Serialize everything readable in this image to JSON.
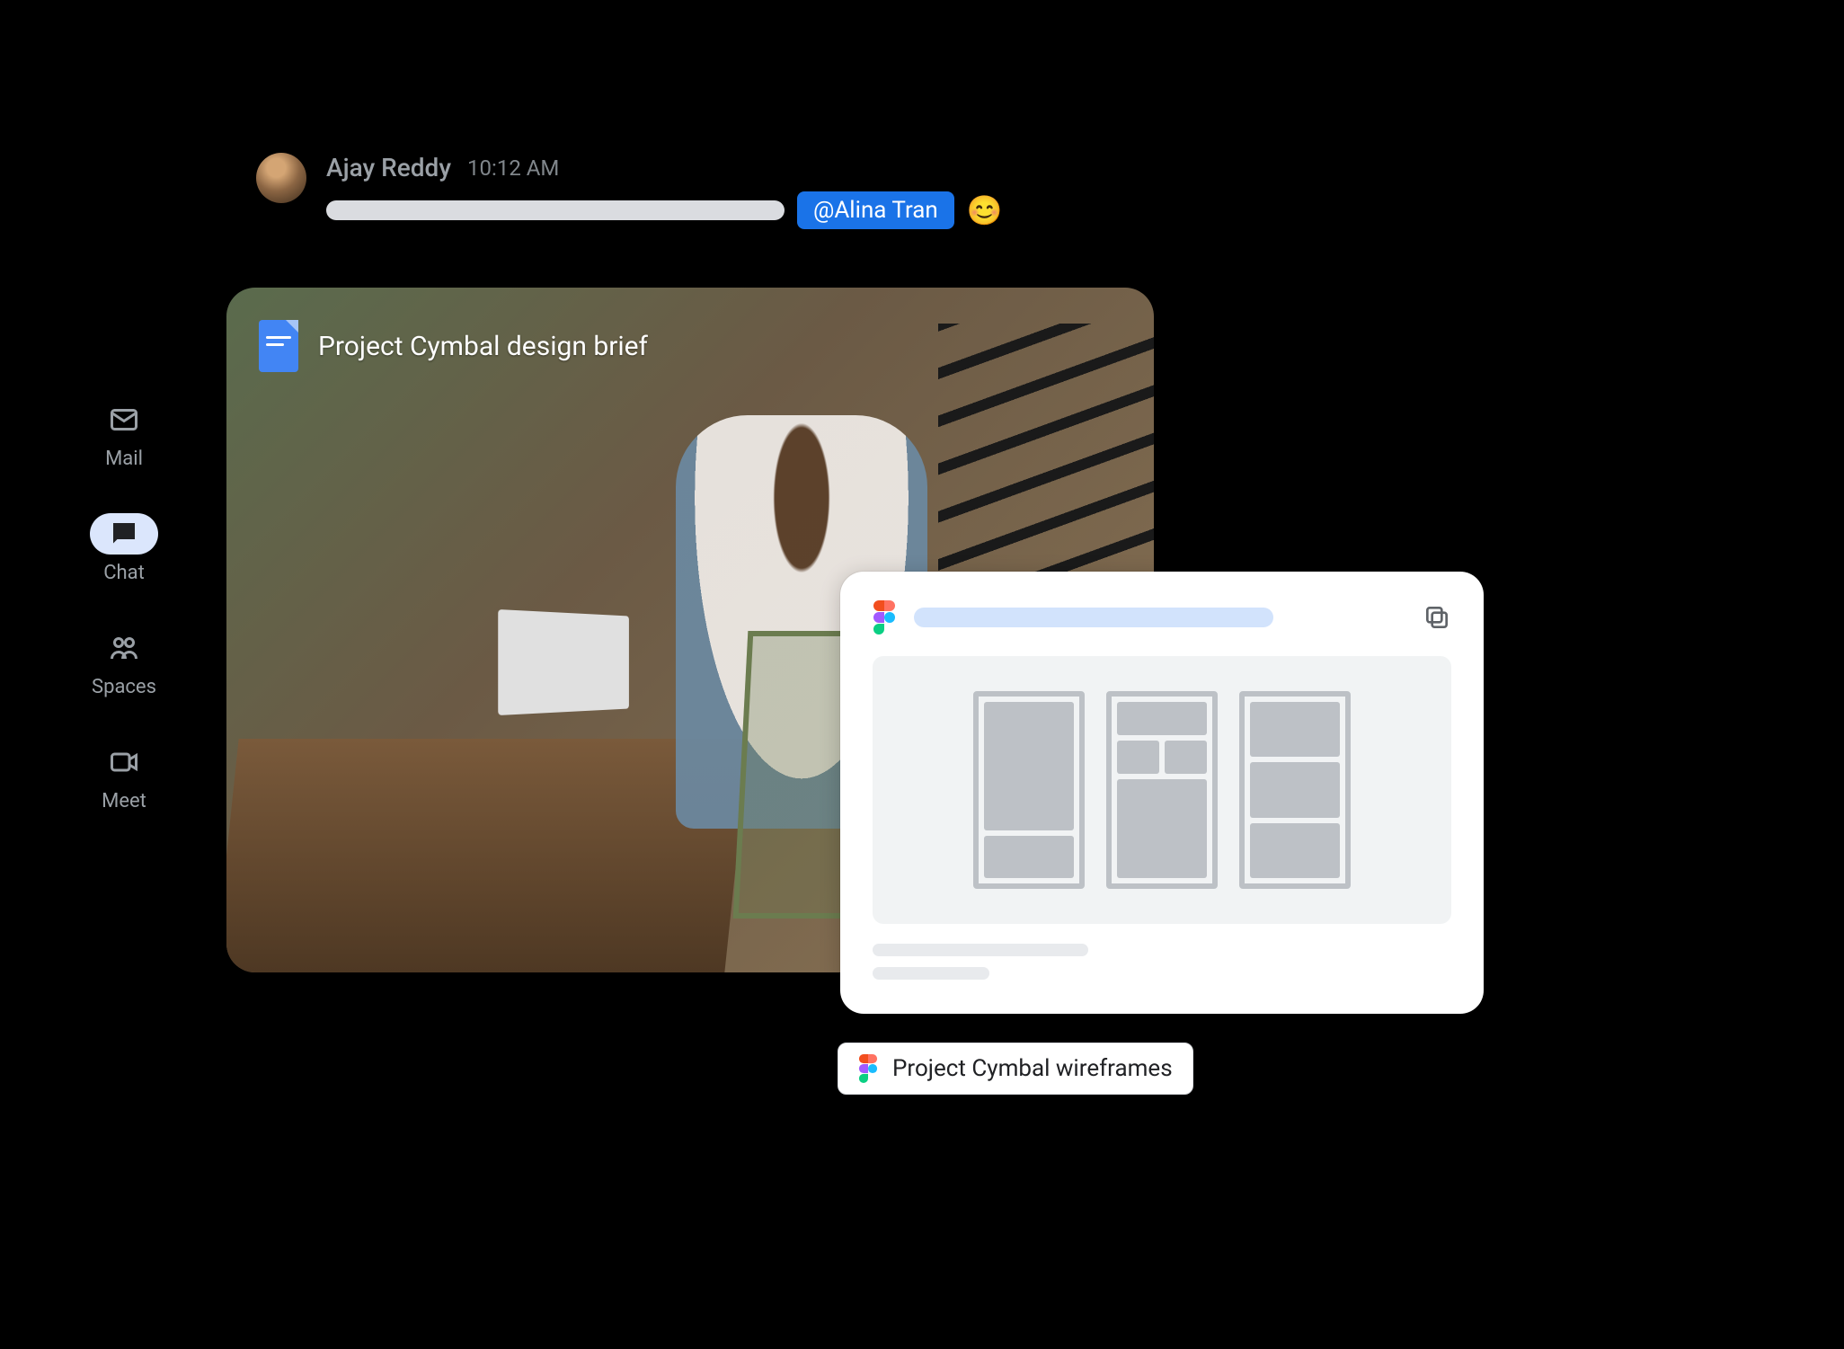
{
  "sidebar": {
    "items": [
      {
        "label": "Mail"
      },
      {
        "label": "Chat"
      },
      {
        "label": "Spaces"
      },
      {
        "label": "Meet"
      }
    ],
    "active_index": 1
  },
  "message": {
    "sender": "Ajay Reddy",
    "time": "10:12 AM",
    "mention": "@Alina Tran",
    "emoji": "😊"
  },
  "attachment": {
    "doc_title": "Project Cymbal design brief"
  },
  "figma_chip": {
    "label": "Project Cymbal wireframes"
  }
}
